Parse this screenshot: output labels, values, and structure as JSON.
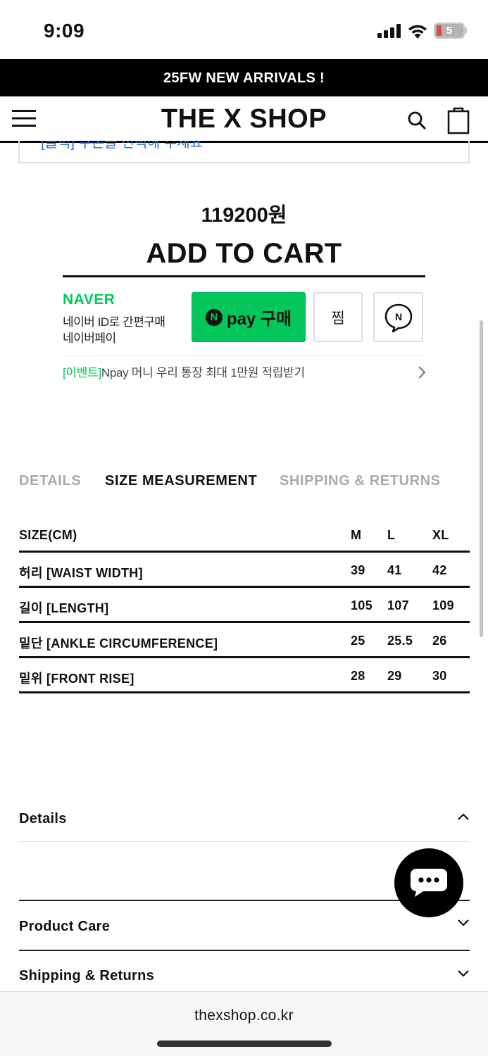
{
  "status_bar": {
    "time": "9:09",
    "battery": "5",
    "icons": [
      "signal-icon",
      "wifi-icon",
      "battery-icon"
    ]
  },
  "announcement": "25FW NEW ARRIVALS !",
  "header": {
    "logo": "THE X SHOP",
    "icons": [
      "menu-icon",
      "search-icon",
      "shopping-bag-icon"
    ]
  },
  "coupon_text": "[클릭] 쿠폰을 선택해 주세요",
  "product": {
    "price": "119200원",
    "add_to_cart": "ADD TO CART"
  },
  "naver": {
    "logo": "NAVER",
    "desc_line1": "네이버 ID로 간편구매",
    "desc_line2": "네이버페이",
    "npay_n": "N",
    "npay_label": "pay 구매",
    "wish_label": "찜",
    "talk_n": "N",
    "event_tag": "[이벤트]",
    "event_text": "Npay 머니 우리 통장 최대 1만원 적립받기",
    "brand_color": "#03c75a"
  },
  "tabs": [
    {
      "label": "DETAILS",
      "active": false
    },
    {
      "label": "SIZE MEASUREMENT",
      "active": true
    },
    {
      "label": "SHIPPING & RETURNS",
      "active": false
    }
  ],
  "size_table": {
    "headers": [
      "SIZE(CM)",
      "M",
      "L",
      "XL"
    ],
    "rows": [
      [
        "허리 [WAIST WIDTH]",
        "39",
        "41",
        "42"
      ],
      [
        "길이 [LENGTH]",
        "105",
        "107",
        "109"
      ],
      [
        "밑단 [ANKLE CIRCUMFERENCE]",
        "25",
        "25.5",
        "26"
      ],
      [
        "밑위 [FRONT RISE]",
        "28",
        "29",
        "30"
      ]
    ]
  },
  "accordions": [
    {
      "title": "Details",
      "state": "expanded"
    },
    {
      "title": "Product Care",
      "state": "collapsed"
    },
    {
      "title": "Shipping & Returns",
      "state": "collapsed"
    }
  ],
  "browser": {
    "url": "thexshop.co.kr"
  }
}
